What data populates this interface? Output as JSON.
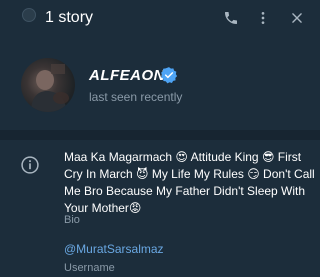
{
  "header": {
    "title": "1 story",
    "icons": [
      "story-avatar-icon",
      "phone-icon",
      "more-vertical-icon",
      "close-icon"
    ]
  },
  "profile": {
    "name": "ALFEAON",
    "verified": true,
    "status": "last seen recently"
  },
  "info": {
    "bio": "Maa Ka Magarmach 😍 Attitude King 😎 First Cry In March 😈 My Life My Rules 😏 Don't Call Me Bro Because My Father Didn't Sleep With Your Mother😡",
    "bio_label": "Bio",
    "username": "@MuratSarsalmaz",
    "username_label": "Username"
  },
  "colors": {
    "background": "#1c2d3b",
    "divider": "#172531",
    "muted_text": "#8a9aa8",
    "link": "#6aa8e3",
    "verified_badge": "#4ea4f5"
  }
}
